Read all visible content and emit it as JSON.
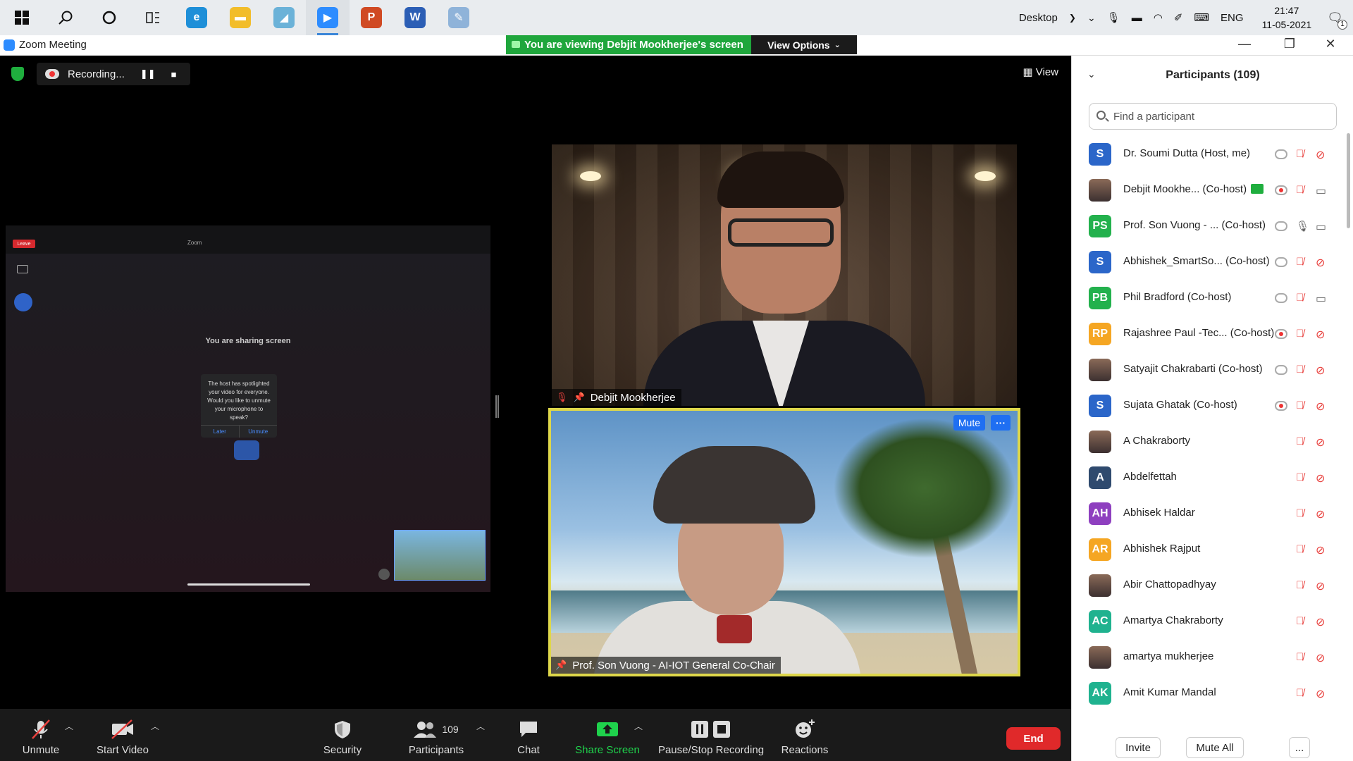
{
  "taskbar": {
    "apps": [
      {
        "name": "edge",
        "color": "#1e8fd8",
        "glyph": "e"
      },
      {
        "name": "file-explorer",
        "color": "#f2bd2a",
        "glyph": "▬"
      },
      {
        "name": "app-blue",
        "color": "#6bb2d8",
        "glyph": "◢"
      },
      {
        "name": "zoom",
        "color": "#2d8cff",
        "glyph": "▶"
      },
      {
        "name": "powerpoint",
        "color": "#d04a23",
        "glyph": "P"
      },
      {
        "name": "word",
        "color": "#2b5eb5",
        "glyph": "W"
      },
      {
        "name": "paint",
        "color": "#8fb3d9",
        "glyph": "✎"
      }
    ],
    "tray": {
      "desktop_label": "Desktop",
      "language": "ENG",
      "time": "21:47",
      "date": "11-05-2021",
      "notification_count": "1"
    }
  },
  "window": {
    "title": "Zoom Meeting",
    "viewing_banner": "You are viewing Debjit Mookherjee's screen",
    "view_options": "View Options"
  },
  "meeting": {
    "recording_label": "Recording...",
    "view_label": "View",
    "shared_screen": {
      "leave": "Leave",
      "zoom_label": "Zoom",
      "sharing_text": "You are sharing screen",
      "dialog_text": "The host has spotlighted your video for everyone. Would you like to unmute your microphone to speak?",
      "dialog_later": "Later",
      "dialog_unmute": "Unmute"
    },
    "tiles": [
      {
        "name": "Debjit Mookherjee"
      },
      {
        "name": "Prof. Son Vuong - AI-IOT General Co-Chair",
        "mute_label": "Mute",
        "more_label": "···"
      }
    ]
  },
  "toolbar": {
    "unmute": "Unmute",
    "start_video": "Start Video",
    "security": "Security",
    "participants": "Participants",
    "participants_count": "109",
    "chat": "Chat",
    "share_screen": "Share Screen",
    "pause_stop_recording": "Pause/Stop Recording",
    "reactions": "Reactions",
    "end": "End",
    "colors": {
      "share_green": "#1fd24c",
      "end_red": "#e0292a"
    }
  },
  "participants_panel": {
    "title": "Participants (109)",
    "search_placeholder": "Find a participant",
    "participants": [
      {
        "initials": "S",
        "color": "#2b66c9",
        "name": "Dr. Soumi Dutta (Host, me)",
        "rec": "grey",
        "mic": "off",
        "cam": "off"
      },
      {
        "initials": "",
        "color": "photo",
        "name": "Debjit Mookhe... (Co-host)",
        "sharing": true,
        "rec": "red",
        "mic": "off",
        "cam": "on"
      },
      {
        "initials": "PS",
        "color": "#23b14d",
        "name": "Prof. Son Vuong - ... (Co-host)",
        "rec": "grey",
        "mic": "on",
        "cam": "on"
      },
      {
        "initials": "S",
        "color": "#2b66c9",
        "name": "Abhishek_SmartSo... (Co-host)",
        "rec": "grey",
        "mic": "off",
        "cam": "off"
      },
      {
        "initials": "PB",
        "color": "#23b14d",
        "name": "Phil Bradford (Co-host)",
        "rec": "grey",
        "mic": "off",
        "cam": "on"
      },
      {
        "initials": "RP",
        "color": "#f5a623",
        "name": "Rajashree Paul -Tec... (Co-host)",
        "rec": "red",
        "mic": "off",
        "cam": "off"
      },
      {
        "initials": "",
        "color": "photo",
        "name": "Satyajit Chakrabarti (Co-host)",
        "rec": "grey",
        "mic": "off",
        "cam": "off"
      },
      {
        "initials": "S",
        "color": "#2b66c9",
        "name": "Sujata Ghatak (Co-host)",
        "rec": "red",
        "mic": "off",
        "cam": "off"
      },
      {
        "initials": "",
        "color": "photo",
        "name": "A Chakraborty",
        "rec": "none",
        "mic": "off",
        "cam": "off"
      },
      {
        "initials": "A",
        "color": "#2f4a6e",
        "name": "Abdelfettah",
        "rec": "none",
        "mic": "off",
        "cam": "off"
      },
      {
        "initials": "AH",
        "color": "#8e3fbf",
        "name": "Abhisek Haldar",
        "rec": "none",
        "mic": "off",
        "cam": "off"
      },
      {
        "initials": "AR",
        "color": "#f5a623",
        "name": "Abhishek Rajput",
        "rec": "none",
        "mic": "off",
        "cam": "off"
      },
      {
        "initials": "",
        "color": "photo",
        "name": "Abir Chattopadhyay",
        "rec": "none",
        "mic": "off",
        "cam": "off"
      },
      {
        "initials": "AC",
        "color": "#1fb28f",
        "name": "Amartya Chakraborty",
        "rec": "none",
        "mic": "off",
        "cam": "off"
      },
      {
        "initials": "",
        "color": "photo",
        "name": "amartya mukherjee",
        "rec": "none",
        "mic": "off",
        "cam": "off"
      },
      {
        "initials": "AK",
        "color": "#1fb28f",
        "name": "Amit Kumar Mandal",
        "rec": "none",
        "mic": "off",
        "cam": "off"
      }
    ],
    "footer": {
      "invite": "Invite",
      "mute_all": "Mute All",
      "more": "..."
    }
  }
}
